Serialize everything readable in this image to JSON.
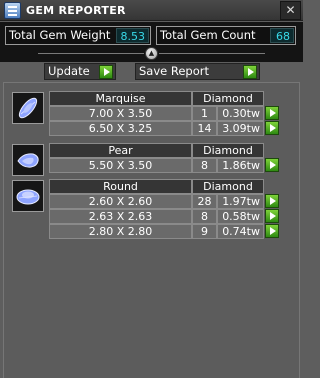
{
  "window": {
    "title": "GEM REPORTER",
    "close_symbol": "✕"
  },
  "stats": {
    "total_weight_label": "Total Gem Weight",
    "total_weight_value": "8.53",
    "total_count_label": "Total Gem Count",
    "total_count_value": "68"
  },
  "actions": {
    "update_label": "Update",
    "save_label": "Save Report"
  },
  "groups": [
    {
      "cut": "Marquise",
      "material": "Diamond",
      "rows": [
        {
          "size": "7.00 X 3.50",
          "count": "1",
          "weight": "0.30tw"
        },
        {
          "size": "6.50 X 3.25",
          "count": "14",
          "weight": "3.09tw"
        }
      ]
    },
    {
      "cut": "Pear",
      "material": "Diamond",
      "rows": [
        {
          "size": "5.50 X 3.50",
          "count": "8",
          "weight": "1.86tw"
        }
      ]
    },
    {
      "cut": "Round",
      "material": "Diamond",
      "rows": [
        {
          "size": "2.60 X 2.60",
          "count": "28",
          "weight": "1.97tw"
        },
        {
          "size": "2.63 X 2.63",
          "count": "8",
          "weight": "0.58tw"
        },
        {
          "size": "2.80 X 2.80",
          "count": "9",
          "weight": "0.74tw"
        }
      ]
    }
  ]
}
